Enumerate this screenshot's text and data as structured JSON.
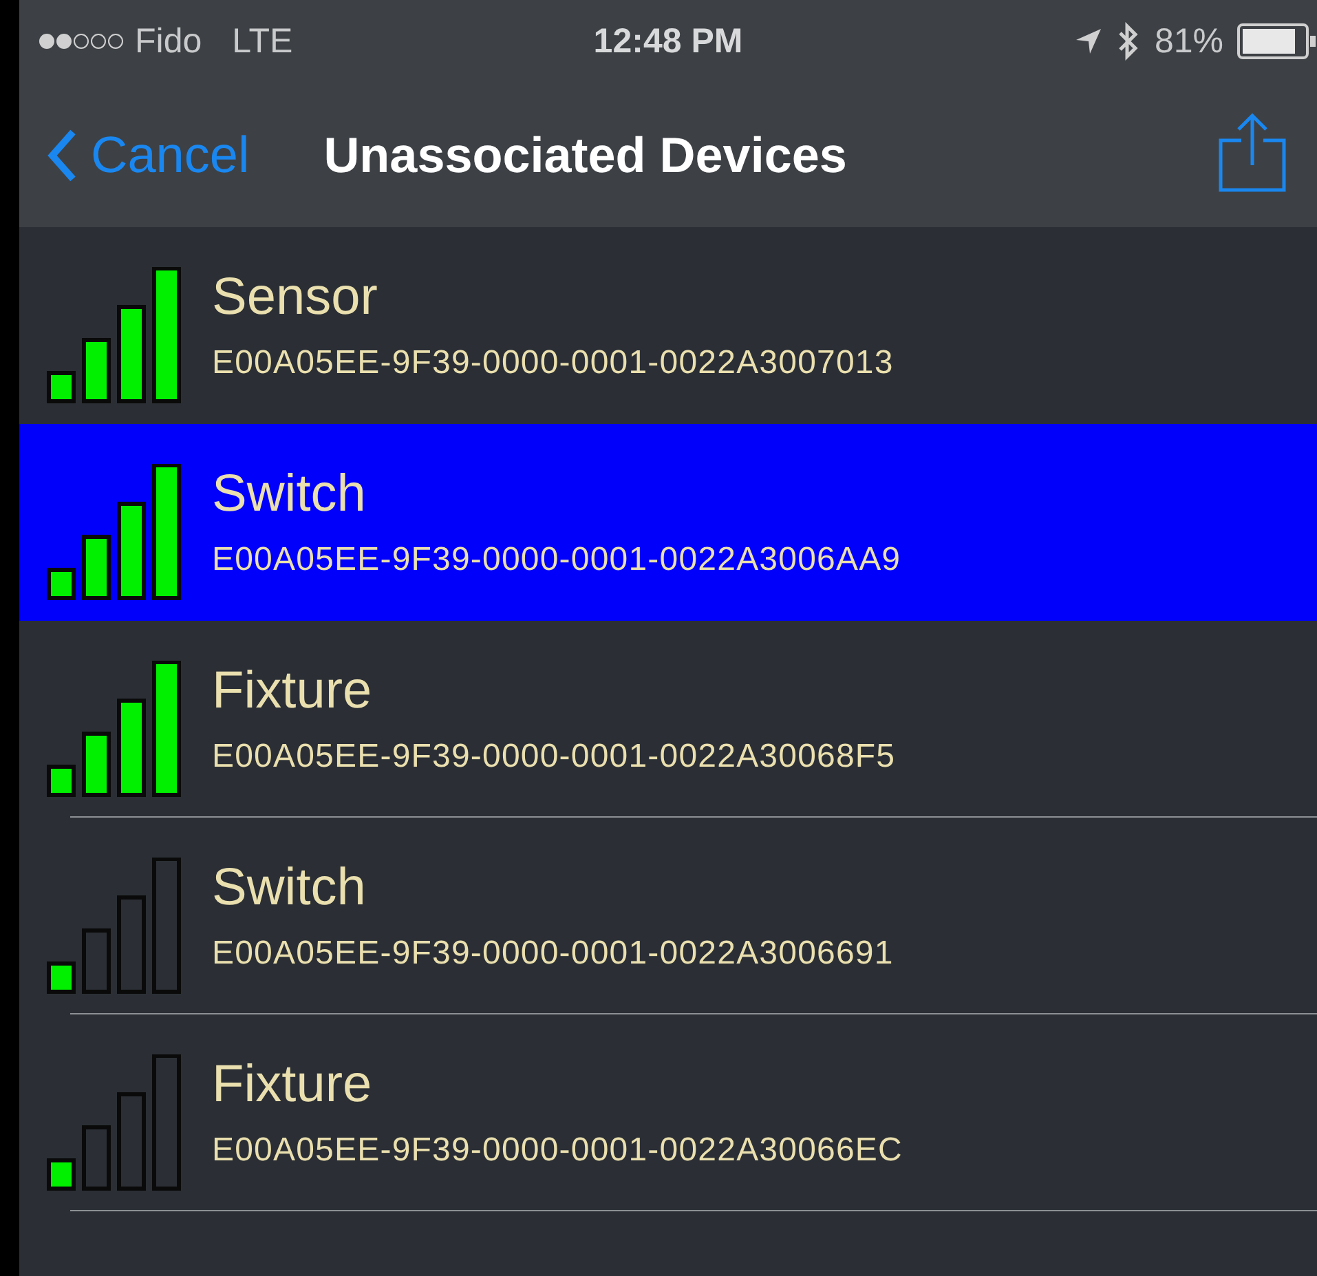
{
  "status_bar": {
    "carrier": "Fido",
    "network": "LTE",
    "time": "12:48 PM",
    "battery": "81%"
  },
  "nav_bar": {
    "back": "Cancel",
    "title": "Unassociated Devices"
  },
  "devices": [
    {
      "name": "Sensor",
      "id": "E00A05EE-9F39-0000-0001-0022A3007013",
      "level": 1,
      "selected": false
    },
    {
      "name": "Switch",
      "id": "E00A05EE-9F39-0000-0001-0022A3006AA9",
      "level": 1,
      "selected": true
    },
    {
      "name": "Fixture",
      "id": "E00A05EE-9F39-0000-0001-0022A30068F5",
      "level": 1,
      "selected": false
    },
    {
      "name": "Switch",
      "id": "E00A05EE-9F39-0000-0001-0022A3006691",
      "level": 0.25,
      "selected": false
    },
    {
      "name": "Fixture",
      "id": "E00A05EE-9F39-0000-0001-0022A30066EC",
      "level": 0.25,
      "selected": false
    }
  ]
}
